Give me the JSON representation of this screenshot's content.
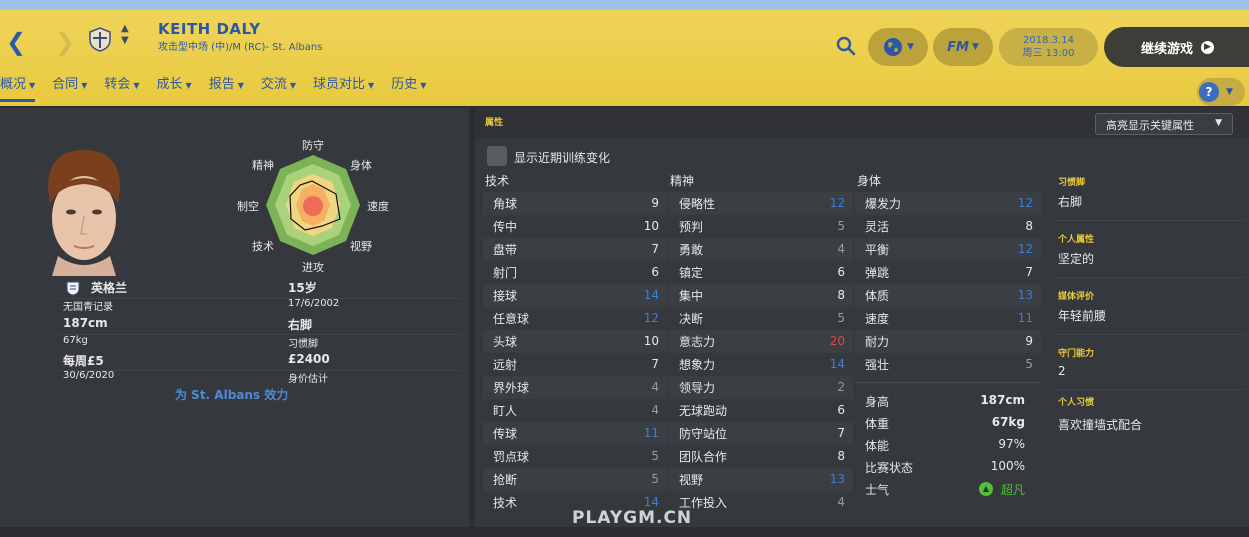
{
  "header": {
    "player_name": "KEITH DALY",
    "player_subtitle": "攻击型中场 (中)/M (RC)- St. Albans",
    "date_line1": "2018.3.14",
    "date_line2": "周三 13:00",
    "continue_label": "继续游戏",
    "fm_label": "FM",
    "help_label": "?"
  },
  "tabs": [
    "概况",
    "合同",
    "转会",
    "成长",
    "报告",
    "交流",
    "球员对比",
    "历史"
  ],
  "profile": {
    "nation": "英格兰",
    "youth_record": "无国青记录",
    "age": "15岁",
    "birth_date": "17/6/2002",
    "height": "187cm",
    "weight": "67kg",
    "foot": "右脚",
    "foot_label": "习惯脚",
    "wage": "每周£5",
    "contract_end": "30/6/2020",
    "value": "£2400",
    "value_label": "身价估计",
    "plays_for": "为 St. Albans 效力"
  },
  "radar": {
    "labels": [
      "防守",
      "身体",
      "速度",
      "视野",
      "进攻",
      "技术",
      "制空",
      "精神"
    ]
  },
  "attributes": {
    "panel_title": "属性",
    "highlight_label": "高亮显示关键属性",
    "show_training_label": "显示近期训练变化",
    "technical_title": "技术",
    "mental_title": "精神",
    "physical_title": "身体",
    "technical": [
      {
        "name": "角球",
        "value": "9"
      },
      {
        "name": "传中",
        "value": "10"
      },
      {
        "name": "盘带",
        "value": "7"
      },
      {
        "name": "射门",
        "value": "6"
      },
      {
        "name": "接球",
        "value": "14"
      },
      {
        "name": "任意球",
        "value": "12"
      },
      {
        "name": "头球",
        "value": "10"
      },
      {
        "name": "远射",
        "value": "7"
      },
      {
        "name": "界外球",
        "value": "4"
      },
      {
        "name": "盯人",
        "value": "4"
      },
      {
        "name": "传球",
        "value": "11"
      },
      {
        "name": "罚点球",
        "value": "5"
      },
      {
        "name": "抢断",
        "value": "5"
      },
      {
        "name": "技术",
        "value": "14"
      }
    ],
    "mental": [
      {
        "name": "侵略性",
        "value": "12"
      },
      {
        "name": "预判",
        "value": "5"
      },
      {
        "name": "勇敢",
        "value": "4"
      },
      {
        "name": "镇定",
        "value": "6"
      },
      {
        "name": "集中",
        "value": "8"
      },
      {
        "name": "决断",
        "value": "5"
      },
      {
        "name": "意志力",
        "value": "20"
      },
      {
        "name": "想象力",
        "value": "14"
      },
      {
        "name": "领导力",
        "value": "2"
      },
      {
        "name": "无球跑动",
        "value": "6"
      },
      {
        "name": "防守站位",
        "value": "7"
      },
      {
        "name": "团队合作",
        "value": "8"
      },
      {
        "name": "视野",
        "value": "13"
      },
      {
        "name": "工作投入",
        "value": "4"
      }
    ],
    "physical": [
      {
        "name": "爆发力",
        "value": "12"
      },
      {
        "name": "灵活",
        "value": "8"
      },
      {
        "name": "平衡",
        "value": "12"
      },
      {
        "name": "弹跳",
        "value": "7"
      },
      {
        "name": "体质",
        "value": "13"
      },
      {
        "name": "速度",
        "value": "11"
      },
      {
        "name": "耐力",
        "value": "9"
      },
      {
        "name": "强壮",
        "value": "5"
      }
    ],
    "stats": [
      {
        "name": "身高",
        "value": "187cm"
      },
      {
        "name": "体重",
        "value": "67kg"
      },
      {
        "name": "体能",
        "value": "97%"
      },
      {
        "name": "比赛状态",
        "value": "100%"
      },
      {
        "name": "士气",
        "value": "超凡"
      }
    ]
  },
  "sidebar": {
    "foot_h": "习惯脚",
    "foot_v": "右脚",
    "personality_h": "个人属性",
    "personality_v": "坚定的",
    "media_h": "媒体评价",
    "media_v": "年轻前腰",
    "gk_h": "守门能力",
    "gk_v": "2",
    "habits_h": "个人习惯",
    "habits_v": "喜欢撞墙式配合"
  },
  "watermark": "PLAYGM.CN",
  "colors": {
    "header_yellow": "#e8c93e",
    "blue_text": "#2b58a6",
    "value_high": "#3b7fd6",
    "value_max": "#e04848",
    "value_low": "#9a9a9a",
    "morale_green": "#4fbf3a"
  }
}
